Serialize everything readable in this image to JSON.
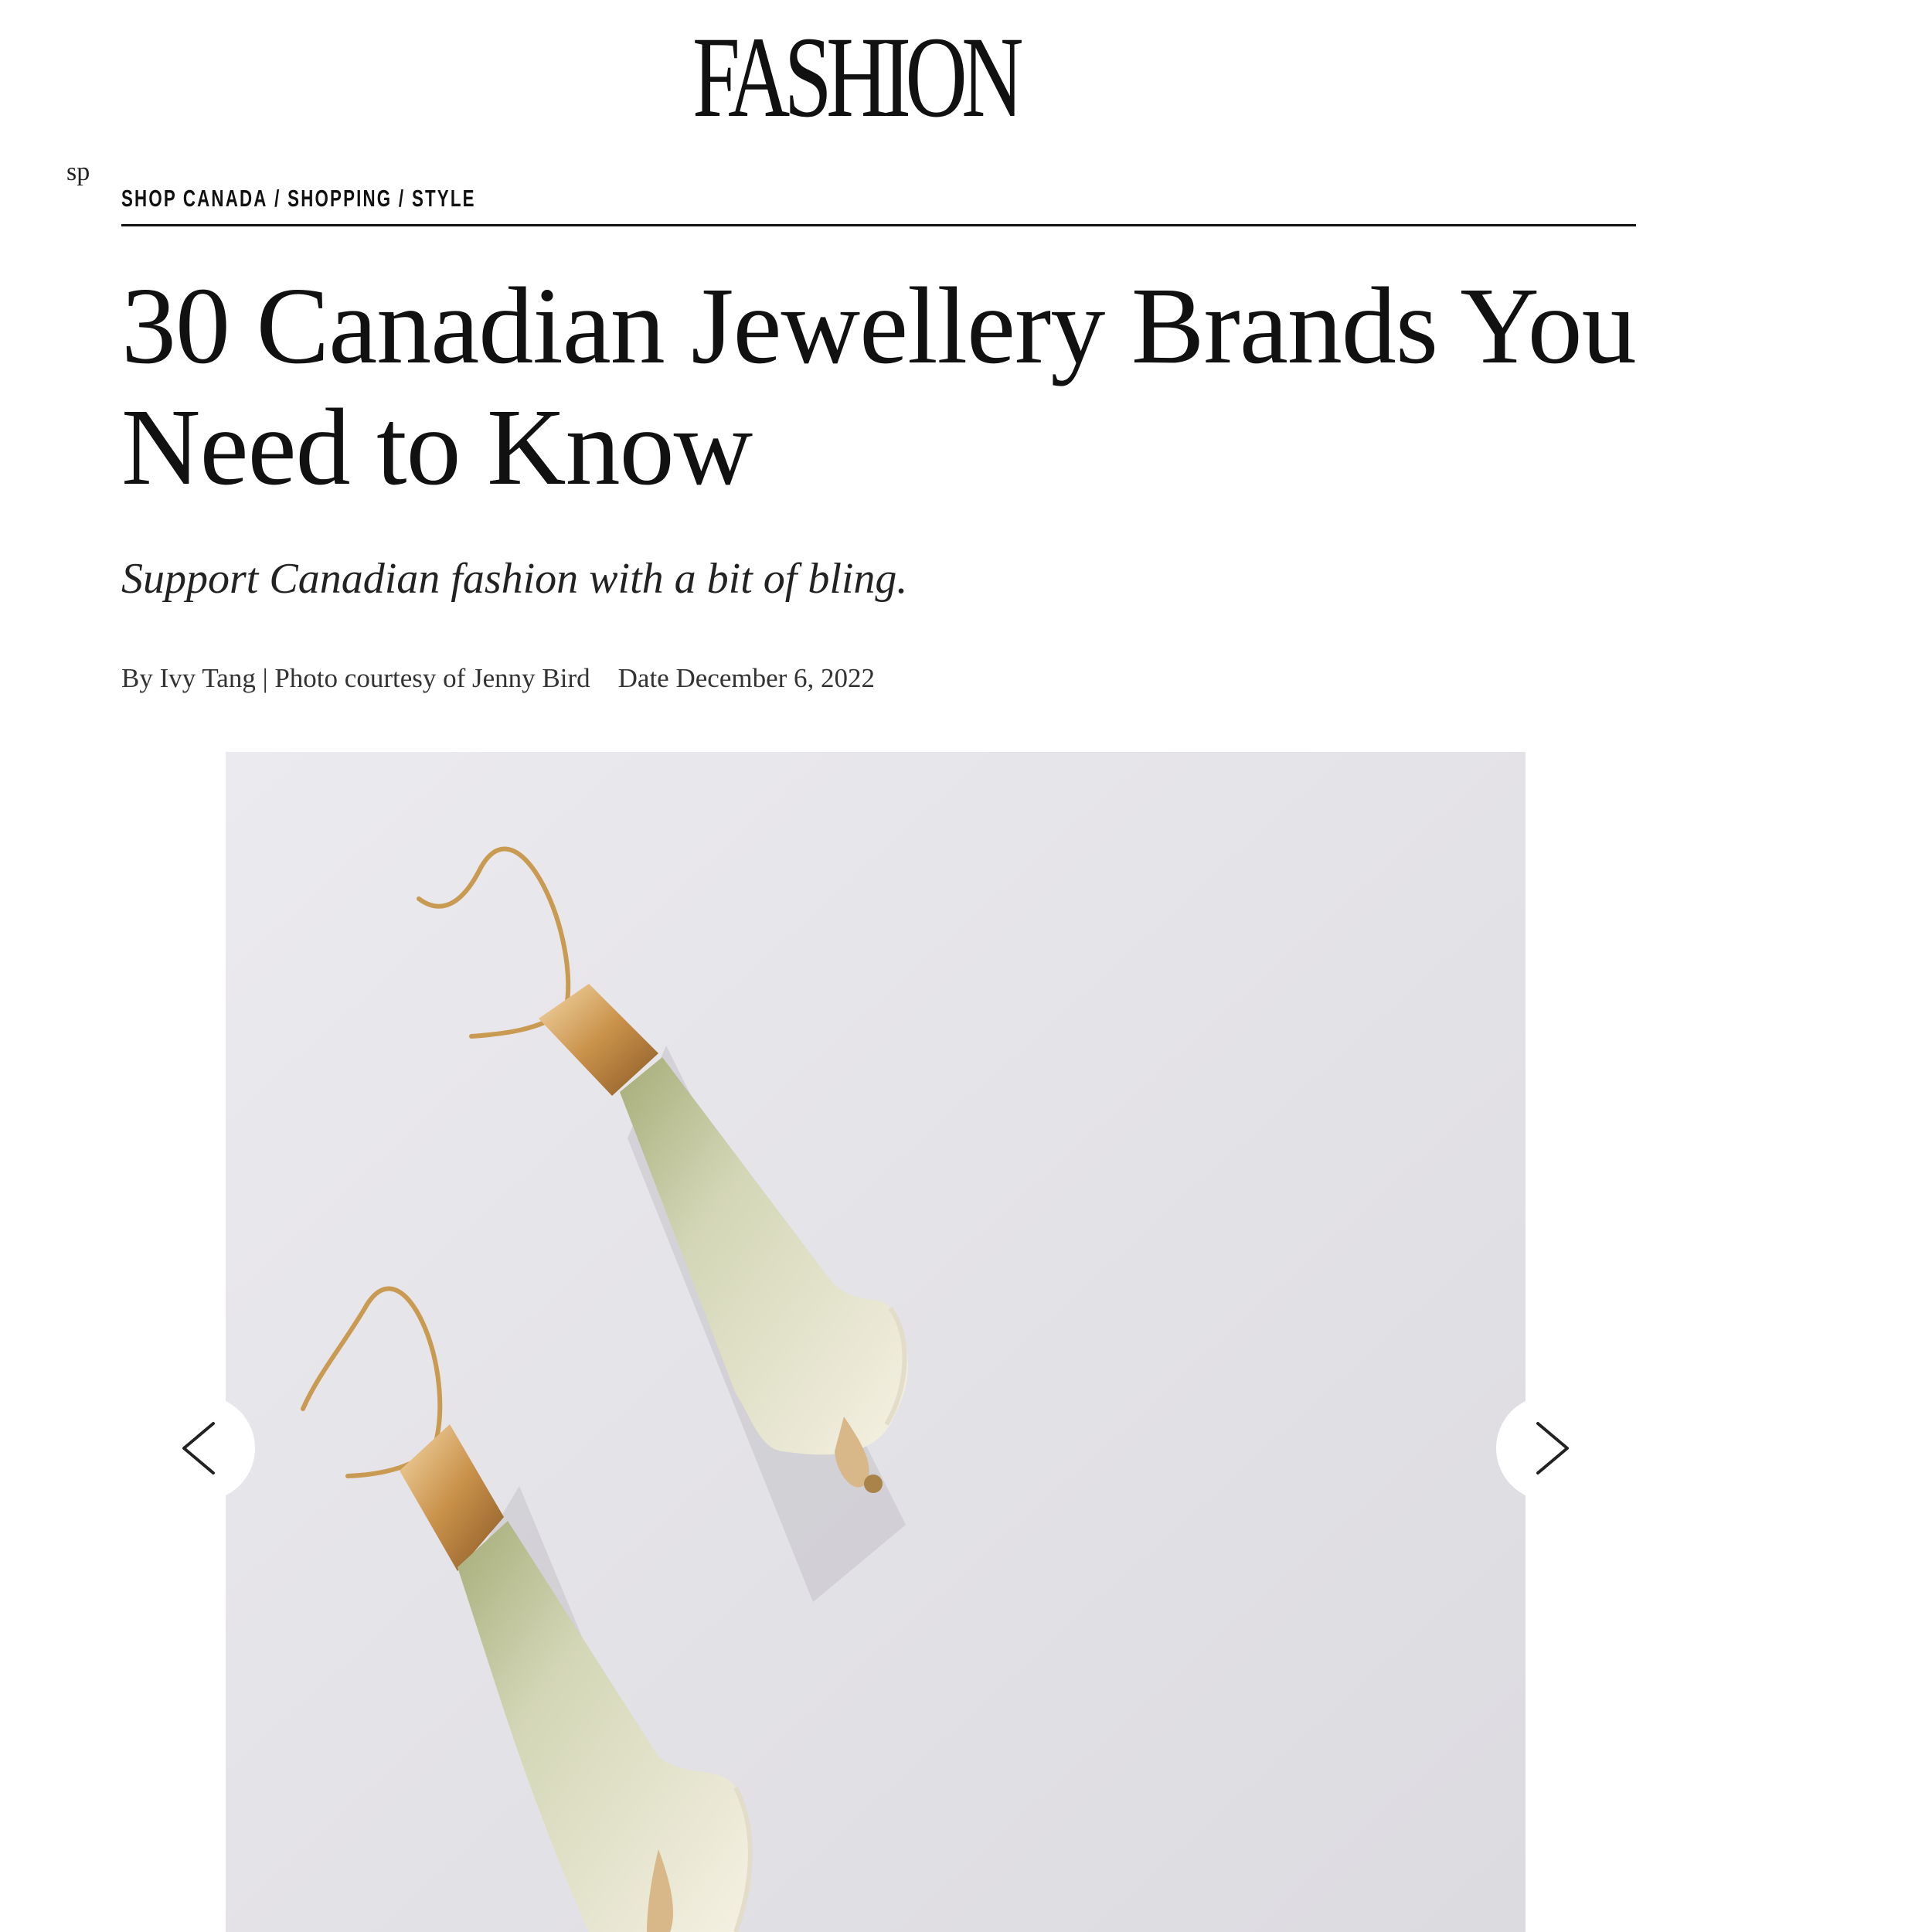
{
  "site": {
    "logo_text": "FASHION"
  },
  "clipped_text": "sp",
  "breadcrumb": {
    "items": [
      "SHOP CANADA",
      "SHOPPING",
      "STYLE"
    ],
    "separator": "/"
  },
  "article": {
    "headline": "30 Canadian Jewellery Brands You Need to Know",
    "dek": "Support Canadian fashion with a bit of bling.",
    "byline": "By Ivy Tang | Photo courtesy of Jenny Bird",
    "date_label": "Date",
    "date": "December 6, 2022"
  },
  "gallery": {
    "image_alt": "Photo courtesy of Jenny Bird",
    "prev_icon": "chevron-left-icon",
    "next_icon": "chevron-right-icon"
  },
  "colors": {
    "text": "#111111",
    "photo_background": "#e6e5e8",
    "gold": "#c99a52",
    "lace_green": "#a9b27c",
    "lace_cream": "#f3efe2"
  }
}
